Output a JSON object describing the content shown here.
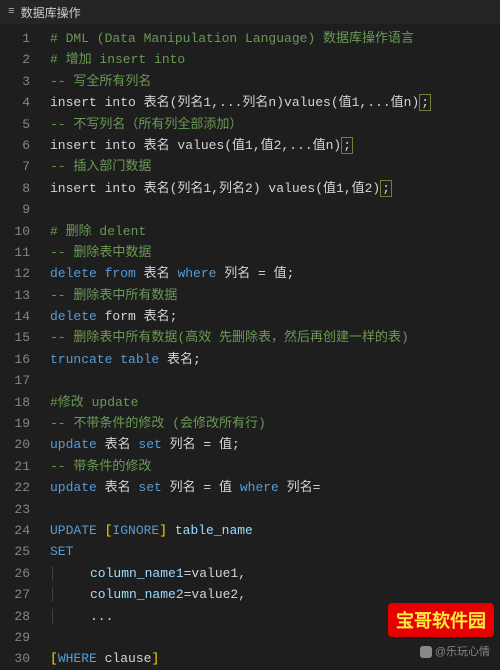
{
  "tab": {
    "icon": "≡",
    "title": "数据库操作"
  },
  "lines": [
    {
      "n": 1,
      "cls": "comment-hash",
      "text": "# DML (Data Manipulation Language) 数据库操作语言"
    },
    {
      "n": 2,
      "cls": "comment-hash",
      "text": "# 增加 insert into"
    },
    {
      "n": 3,
      "cls": "comment-dd",
      "text": "-- 写全所有列名"
    },
    {
      "n": 4,
      "raw": true
    },
    {
      "n": 5,
      "cls": "comment-dd",
      "text": "-- 不写列名（所有列全部添加）"
    },
    {
      "n": 6,
      "raw": true
    },
    {
      "n": 7,
      "cls": "comment-dd",
      "text": "-- 插入部门数据"
    },
    {
      "n": 8,
      "raw": true
    },
    {
      "n": 9,
      "cls": "",
      "text": ""
    },
    {
      "n": 10,
      "cls": "comment-hash",
      "text": "# 删除 delent"
    },
    {
      "n": 11,
      "cls": "comment-dd",
      "text": "-- 删除表中数据"
    },
    {
      "n": 12,
      "raw": true
    },
    {
      "n": 13,
      "cls": "comment-dd",
      "text": "-- 删除表中所有数据"
    },
    {
      "n": 14,
      "raw": true
    },
    {
      "n": 15,
      "cls": "comment-dd",
      "text": "-- 删除表中所有数据(高效 先删除表，然后再创建一样的表)"
    },
    {
      "n": 16,
      "raw": true
    },
    {
      "n": 17,
      "cls": "",
      "text": ""
    },
    {
      "n": 18,
      "cls": "comment-hash",
      "text": "#修改 update"
    },
    {
      "n": 19,
      "cls": "comment-dd",
      "text": "-- 不带条件的修改 (会修改所有行)"
    },
    {
      "n": 20,
      "raw": true
    },
    {
      "n": 21,
      "cls": "comment-dd",
      "text": "-- 带条件的修改"
    },
    {
      "n": 22,
      "raw": true
    },
    {
      "n": 23,
      "cls": "",
      "text": ""
    },
    {
      "n": 24,
      "raw": true
    },
    {
      "n": 25,
      "raw": true
    },
    {
      "n": 26,
      "raw": true
    },
    {
      "n": 27,
      "raw": true
    },
    {
      "n": 28,
      "raw": true
    },
    {
      "n": 29,
      "cls": "",
      "text": ""
    },
    {
      "n": 30,
      "raw": true
    }
  ],
  "code_tokens": {
    "l4": {
      "pre": "insert into 表名(列名1,...列名n)values(值1,...值n)",
      "semi": ";"
    },
    "l6": {
      "pre": "insert into 表名 values(值1,值2,...值n)",
      "semi": ";"
    },
    "l8": {
      "pre": "insert into 表名(列名1,列名2) values(值1,值2)",
      "semi": ";"
    },
    "l12": {
      "kw1": "delete from",
      "rest": " 表名 ",
      "kw2": "where",
      "rest2": " 列名 = 值;"
    },
    "l14": {
      "kw1": "delete",
      "rest": " form 表名;"
    },
    "l16": {
      "kw1": "truncate table",
      "rest": " 表名;"
    },
    "l20": {
      "kw1": "update",
      "m1": " 表名 ",
      "kw2": "set",
      "m2": " 列名 = 值;"
    },
    "l22": {
      "kw1": "update",
      "m1": " 表名 ",
      "kw2": "set",
      "m2": " 列名 = 值 ",
      "kw3": "where",
      "m3": " 列名="
    },
    "l24": {
      "kw1": "UPDATE",
      "b1": " [",
      "kw2": "IGNORE",
      "b2": "] ",
      "id": "table_name"
    },
    "l25": {
      "kw1": "SET"
    },
    "l26": {
      "id": "column_name1",
      "rest": "=value1,"
    },
    "l27": {
      "id": "column_name2",
      "rest": "=value2,"
    },
    "l28": {
      "rest": "..."
    },
    "l30": {
      "b1": "[",
      "kw1": "WHERE",
      "rest": " clause",
      "b2": "]"
    }
  },
  "watermark": {
    "red": "宝哥软件园",
    "grey": "@乐玩心情"
  },
  "chart_data": null
}
